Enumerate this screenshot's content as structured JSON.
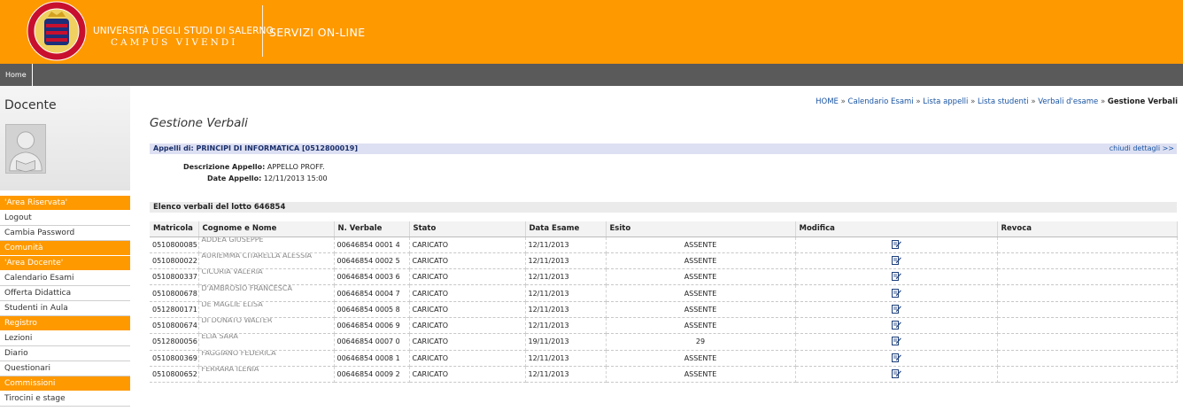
{
  "header": {
    "university_line1": "UNIVERSITÀ DEGLI STUDI DI SALERNO",
    "university_line2": "CAMPUS VIVENDI",
    "service_title": "SERVIZI ON-LINE",
    "logo_icon": "university-seal-icon"
  },
  "nav": {
    "home": "Home"
  },
  "sidebar": {
    "role": "Docente",
    "avatar_icon": "user-placeholder-icon",
    "menu": [
      {
        "label": "'Area Riservata'",
        "section": true
      },
      {
        "label": "Logout",
        "section": false
      },
      {
        "label": "Cambia Password",
        "section": false
      },
      {
        "label": "Comunità",
        "section": true
      },
      {
        "label": "'Area Docente'",
        "section": true
      },
      {
        "label": "Calendario Esami",
        "section": false
      },
      {
        "label": "Offerta Didattica",
        "section": false
      },
      {
        "label": "Studenti in Aula",
        "section": false
      },
      {
        "label": "Registro",
        "section": true
      },
      {
        "label": "Lezioni",
        "section": false
      },
      {
        "label": "Diario",
        "section": false
      },
      {
        "label": "Questionari",
        "section": false
      },
      {
        "label": "Commissioni",
        "section": true
      },
      {
        "label": "Tirocini e stage",
        "section": false
      }
    ]
  },
  "breadcrumb": {
    "items": [
      "HOME",
      "Calendario Esami",
      "Lista appelli",
      "Lista studenti",
      "Verbali d'esame"
    ],
    "separator": "»",
    "current": "Gestione Verbali"
  },
  "main": {
    "title": "Gestione Verbali",
    "appelli_label": "Appelli di: PRINCIPI DI INFORMATICA [0512800019]",
    "close_details": "chiudi dettagli >>",
    "details": {
      "descrizione_label": "Descrizione Appello:",
      "descrizione_value": "APPELLO PROFF.",
      "date_label": "Date Appello:",
      "date_value": "12/11/2013 15:00"
    },
    "elenco_label": "Elenco verbali del lotto 646854"
  },
  "table": {
    "columns": [
      "Matricola",
      "Cognome e Nome",
      "N. Verbale",
      "Stato",
      "Data Esame",
      "Esito",
      "Modifica",
      "Revoca"
    ],
    "rows": [
      {
        "matricola": "0510800085",
        "nome": "ADDEA GIUSEPPE",
        "verbale": "00646854 0001 4",
        "stato": "CARICATO",
        "data": "12/11/2013",
        "esito": "ASSENTE"
      },
      {
        "matricola": "0510800022",
        "nome": "AURIEMMA CITARELLA ALESSIA",
        "verbale": "00646854 0002 5",
        "stato": "CARICATO",
        "data": "12/11/2013",
        "esito": "ASSENTE"
      },
      {
        "matricola": "0510800337",
        "nome": "CICORIA VALERIA",
        "verbale": "00646854 0003 6",
        "stato": "CARICATO",
        "data": "12/11/2013",
        "esito": "ASSENTE"
      },
      {
        "matricola": "0510800678",
        "nome": "D'AMBROSIO FRANCESCA",
        "verbale": "00646854 0004 7",
        "stato": "CARICATO",
        "data": "12/11/2013",
        "esito": "ASSENTE"
      },
      {
        "matricola": "0512800171",
        "nome": "DE MAGLIE ELISA",
        "verbale": "00646854 0005 8",
        "stato": "CARICATO",
        "data": "12/11/2013",
        "esito": "ASSENTE"
      },
      {
        "matricola": "0510800674",
        "nome": "DI DONATO WALTER",
        "verbale": "00646854 0006 9",
        "stato": "CARICATO",
        "data": "12/11/2013",
        "esito": "ASSENTE"
      },
      {
        "matricola": "0512800056",
        "nome": "ELIA SARA",
        "verbale": "00646854 0007 0",
        "stato": "CARICATO",
        "data": "19/11/2013",
        "esito": "29"
      },
      {
        "matricola": "0510800369",
        "nome": "FAGGIANO FEDERICA",
        "verbale": "00646854 0008 1",
        "stato": "CARICATO",
        "data": "12/11/2013",
        "esito": "ASSENTE"
      },
      {
        "matricola": "0510800652",
        "nome": "FERRARA ILENIA",
        "verbale": "00646854 0009 2",
        "stato": "CARICATO",
        "data": "12/11/2013",
        "esito": "ASSENTE"
      }
    ],
    "edit_icon": "edit-document-icon"
  },
  "colors": {
    "brand_orange": "#ff9900",
    "nav_gray": "#5a5a5a",
    "link_blue": "#1a55a3",
    "appelli_bar": "#dde0f2"
  }
}
